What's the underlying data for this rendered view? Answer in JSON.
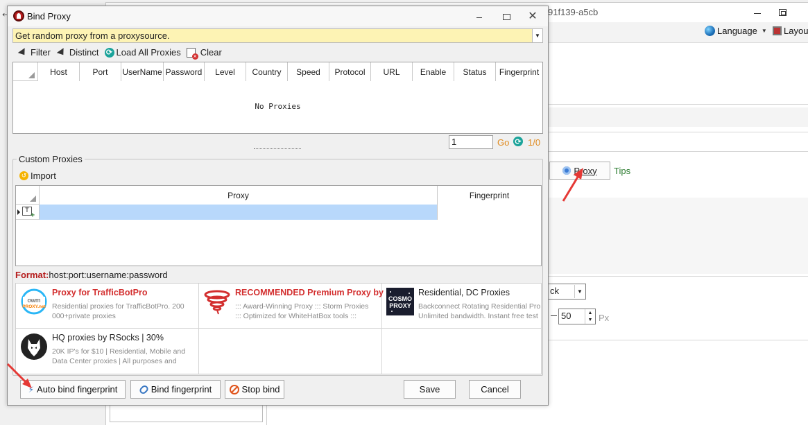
{
  "background": {
    "title_fragment": "91f139-a5cb",
    "menu": [
      {
        "label": "Language",
        "icon": "globe-icon"
      },
      {
        "label": "Layout",
        "icon": "layout-icon"
      }
    ],
    "proxy_button_label": "Proxy",
    "tips_label": "Tips",
    "select_value": "ck",
    "spin_value": "50",
    "unit_label": "Px"
  },
  "dialog": {
    "title": "Bind Proxy",
    "proxy_source": "Get random proxy from a proxysource.",
    "toolbar": {
      "filter": "Filter",
      "distinct": "Distinct",
      "load_all": "Load All Proxies",
      "clear": "Clear"
    },
    "proxy_columns": [
      "Host",
      "Port",
      "UserName",
      "Password",
      "Level",
      "Country",
      "Speed",
      "Protocol",
      "URL",
      "Enable",
      "Status",
      "Fingerprint"
    ],
    "empty_text": "No Proxies",
    "pager": {
      "page": "1",
      "go": "Go",
      "count": "1/0"
    },
    "custom": {
      "group_label": "Custom Proxies",
      "import_label": "Import",
      "columns": [
        "Proxy",
        "Fingerprint"
      ],
      "format_label": "Format:",
      "format_value": "host:port:username:password"
    },
    "ads": [
      {
        "title": "Proxy for TrafficBotPro",
        "title_red": true,
        "desc1": "Residential proxies for TrafficBotPro. 200",
        "desc2": "000+private proxies",
        "logo": "owm-proxy-logo"
      },
      {
        "title": "RECOMMENDED Premium Proxy by",
        "title_red": true,
        "desc1": "::: Award-Winning Proxy ::: Storm Proxies",
        "desc2": "::: Optimized for WhiteHatBox tools :::",
        "logo": "storm-proxies-logo"
      },
      {
        "title": "Residential, DC Proxies",
        "title_red": false,
        "desc1": "Backconnect Rotating Residential Pro",
        "desc2": "Unlimited bandwidth. Instant free test",
        "logo": "cosmo-proxy-logo"
      },
      {
        "title": "HQ proxies by RSocks | 30%",
        "title_red": false,
        "desc1": "20K IP's for $10 | Residential, Mobile and",
        "desc2": "Data Center proxies | All purposes and",
        "logo": "rsocks-wolf-logo"
      }
    ],
    "cosmo_logo_text": [
      "COSMO",
      "PROXY"
    ],
    "owm_logo_text": [
      "owm",
      "PROXY.net"
    ],
    "buttons": {
      "auto_bind": "Auto bind fingerprint",
      "bind": "Bind fingerprint",
      "stop": "Stop bind",
      "save": "Save",
      "cancel": "Cancel"
    }
  }
}
